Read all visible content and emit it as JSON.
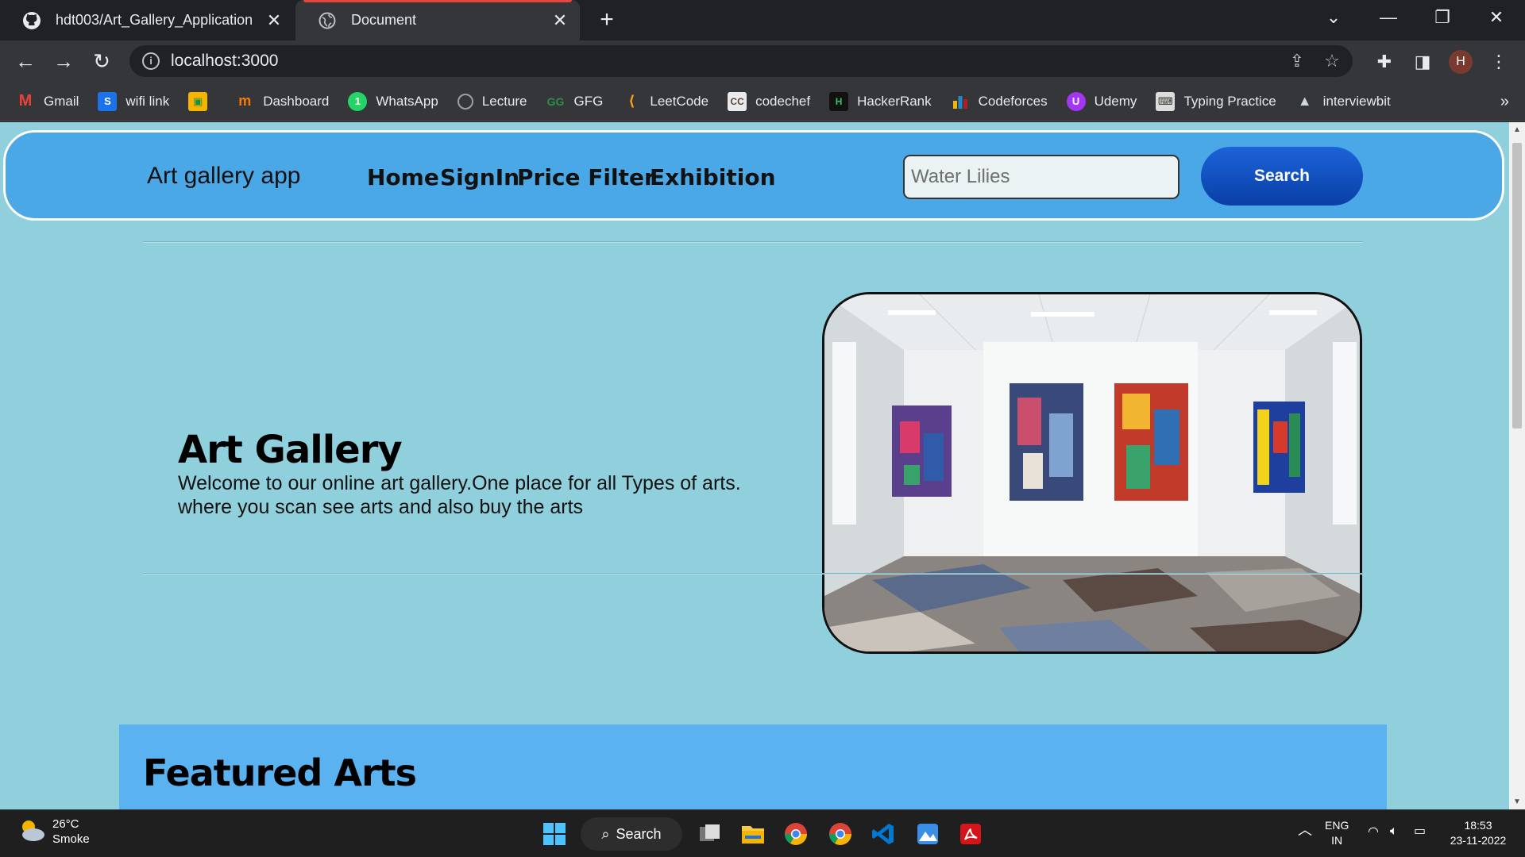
{
  "browser": {
    "tabs": [
      {
        "title": "hdt003/Art_Gallery_Application",
        "icon": "github-icon"
      },
      {
        "title": "Document",
        "icon": "globe-icon"
      }
    ],
    "url": "localhost:3000",
    "profile_initial": "H",
    "bookmarks": [
      {
        "label": "Gmail",
        "icon": "gmail-icon",
        "color": "#ea4335"
      },
      {
        "label": "wifi link",
        "icon": "s-icon",
        "color": "#1a73e8"
      },
      {
        "label": "",
        "icon": "contacts-icon",
        "color": "#f4b400"
      },
      {
        "label": "Dashboard",
        "icon": "dashboard-icon",
        "color": "#f57c00"
      },
      {
        "label": "WhatsApp",
        "icon": "whatsapp-icon",
        "color": "#25d366"
      },
      {
        "label": "Lecture",
        "icon": "globe-icon",
        "color": "#9aa0a6"
      },
      {
        "label": "GFG",
        "icon": "gfg-icon",
        "color": "#2f8d46"
      },
      {
        "label": "LeetCode",
        "icon": "leetcode-icon",
        "color": "#ffa116"
      },
      {
        "label": "codechef",
        "icon": "codechef-icon",
        "color": "#5b4638"
      },
      {
        "label": "HackerRank",
        "icon": "hackerrank-icon",
        "color": "#111111"
      },
      {
        "label": "Codeforces",
        "icon": "codeforces-icon",
        "color": "#1f8acb"
      },
      {
        "label": "Udemy",
        "icon": "udemy-icon",
        "color": "#a435f0"
      },
      {
        "label": "Typing Practice",
        "icon": "typing-icon",
        "color": "#dddddd"
      },
      {
        "label": "interviewbit",
        "icon": "interviewbit-icon",
        "color": "#cfd8dc"
      }
    ]
  },
  "site": {
    "brand": "Art gallery app",
    "nav": [
      "Home",
      "SignIn",
      "Price Filter",
      "Exhibition"
    ],
    "search_placeholder": "Water Lilies",
    "search_button": "Search",
    "hero_title": "Art Gallery",
    "hero_text_line1": "Welcome to our online art gallery.One place for all Types of arts.",
    "hero_text_line2": "where you scan see arts and also buy the arts",
    "featured_title": "Featured Arts"
  },
  "taskbar": {
    "temperature": "26°C",
    "weather": "Smoke",
    "search_label": "Search",
    "lang": "ENG",
    "region": "IN",
    "time": "18:53",
    "date": "23-11-2022"
  },
  "colors": {
    "page_bg": "#90cfdc",
    "nav_bg": "#4aa8e6",
    "featured_bg": "#5ab3f0",
    "search_button": "#1451c4"
  }
}
